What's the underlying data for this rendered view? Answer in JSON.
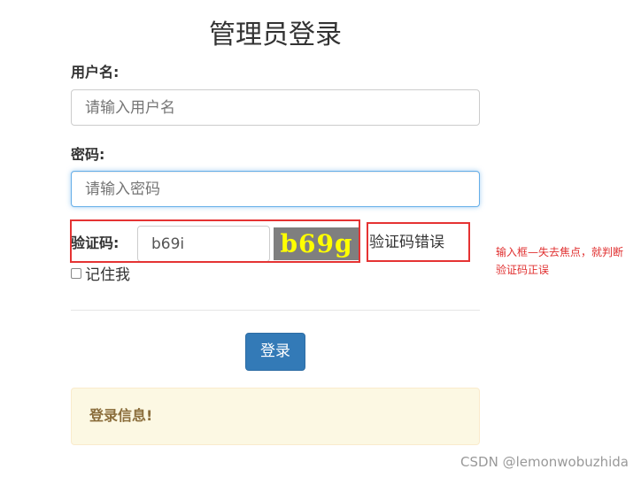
{
  "page": {
    "title": "管理员登录"
  },
  "form": {
    "username_label": "用户名:",
    "username_placeholder": "请输入用户名",
    "password_label": "密码:",
    "password_placeholder": "请输入密码",
    "captcha_label": "验证码:",
    "captcha_value": "b69i",
    "captcha_image_text": "b69g",
    "captcha_error": "验证码错误",
    "remember_label": "记住我",
    "remember_checked": false,
    "submit_label": "登录"
  },
  "info_box": {
    "text": "登录信息!"
  },
  "annotation": {
    "text": "输入框—失去焦点，就判断验证码正误"
  },
  "watermark": {
    "text": "CSDN @lemonwobuzhida"
  },
  "colors": {
    "primary_button": "#337ab7",
    "annotation_red": "#e53333",
    "info_bg": "#fcf8e3",
    "info_text": "#8a6d3b",
    "captcha_bg": "#7f7f7f",
    "captcha_text": "#ffff00"
  }
}
